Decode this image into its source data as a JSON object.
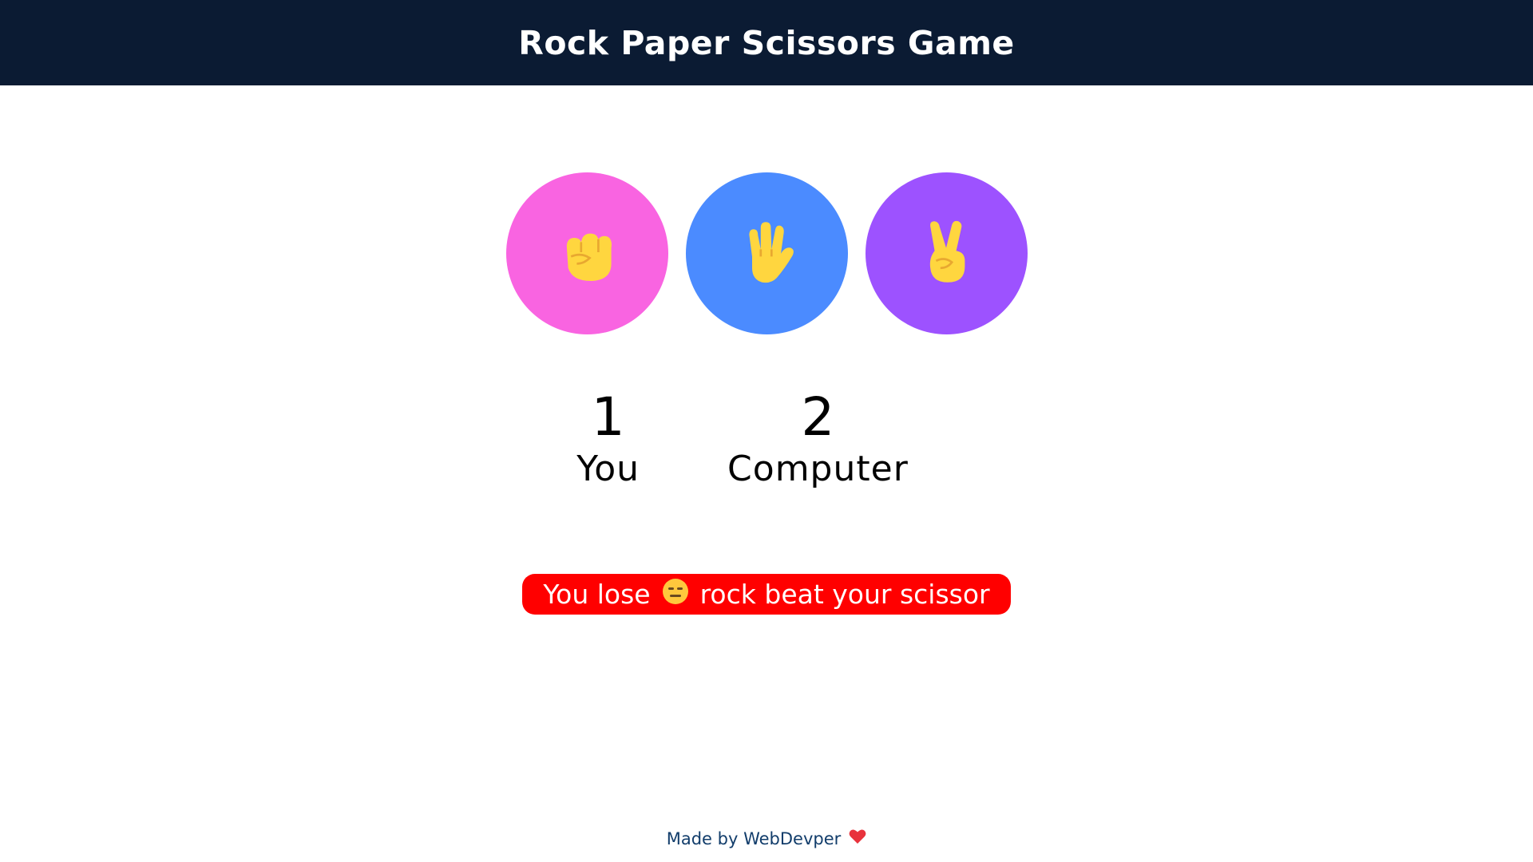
{
  "header": {
    "title": "Rock Paper Scissors Game"
  },
  "choices": [
    {
      "name": "rock",
      "color": "#f964e1",
      "icon": "raised-fist-icon"
    },
    {
      "name": "paper",
      "color": "#4b8bff",
      "icon": "raised-hand-icon"
    },
    {
      "name": "scissors",
      "color": "#9d52ff",
      "icon": "victory-hand-icon"
    }
  ],
  "scores": {
    "user": {
      "value": "1",
      "label": "You"
    },
    "computer": {
      "value": "2",
      "label": "Computer"
    }
  },
  "message": {
    "prefix": "You lose",
    "emoji": "expressionless-face-icon",
    "suffix": "rock beat your scissor",
    "bg_color": "#ff0000"
  },
  "footer": {
    "text": "Made by WebDevper",
    "icon": "heart-icon"
  }
}
